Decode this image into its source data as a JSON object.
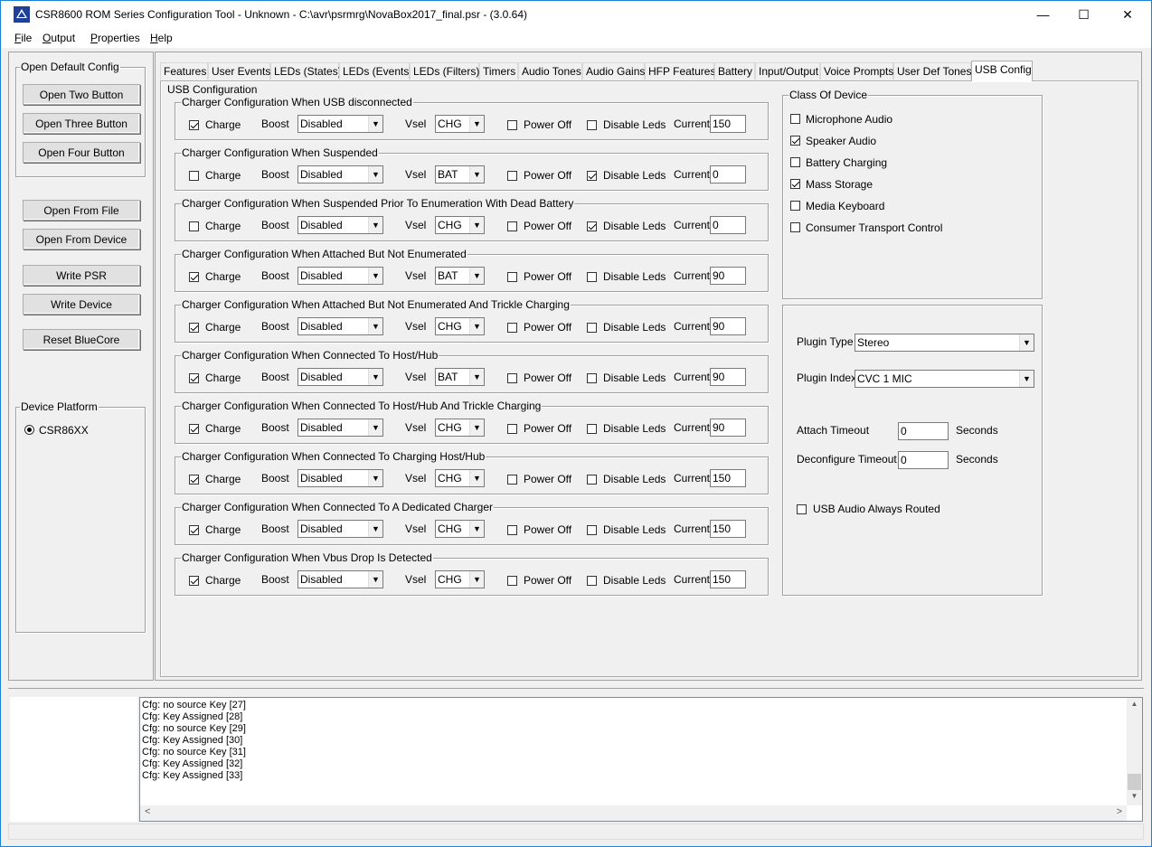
{
  "window": {
    "title": "CSR8600 ROM Series Configuration Tool - Unknown - C:\\avr\\psrmrg\\NovaBox2017_final.psr - (3.0.64)",
    "minimize_label": "—",
    "maximize_label": "☐",
    "close_label": "✕"
  },
  "menubar": {
    "items": [
      {
        "label": "File",
        "underline": "F",
        "rest": "ile"
      },
      {
        "label": "Output",
        "underline": "O",
        "rest": "utput"
      },
      {
        "label": "Properties",
        "underline": "P",
        "rest": "roperties"
      },
      {
        "label": "Help",
        "underline": "H",
        "rest": "elp"
      }
    ]
  },
  "sidebar": {
    "open_default_title": "Open Default Config",
    "open_two": "Open Two Button",
    "open_three": "Open Three Button",
    "open_four": "Open Four Button",
    "open_file": "Open From File",
    "open_device": "Open From Device",
    "write_psr": "Write PSR",
    "write_device": "Write Device",
    "reset": "Reset BlueCore",
    "platform_title": "Device Platform",
    "platform_option": "CSR86XX"
  },
  "tabs": [
    "Features",
    "User Events",
    "LEDs (States)",
    "LEDs (Events)",
    "LEDs (Filters)",
    "Timers",
    "Audio Tones",
    "Audio Gains",
    "HFP Features",
    "Battery",
    "Input/Output",
    "Voice Prompts",
    "User Def Tones",
    "USB Config"
  ],
  "active_tab": "USB Config",
  "usb": {
    "group_title": "USB Configuration",
    "labels": {
      "charge": "Charge",
      "boost": "Boost",
      "vsel": "Vsel",
      "power_off": "Power Off",
      "disable_leds": "Disable Leds",
      "current": "Current"
    },
    "chargers": [
      {
        "title": "Charger Configuration When USB disconnected",
        "charge": true,
        "boost": "Disabled",
        "vsel": "CHG",
        "power_off": false,
        "disable_leds": false,
        "current": "150"
      },
      {
        "title": "Charger Configuration When Suspended",
        "charge": false,
        "boost": "Disabled",
        "vsel": "BAT",
        "power_off": false,
        "disable_leds": true,
        "current": "0"
      },
      {
        "title": "Charger Configuration When Suspended Prior To Enumeration With Dead Battery",
        "charge": false,
        "boost": "Disabled",
        "vsel": "CHG",
        "power_off": false,
        "disable_leds": true,
        "current": "0"
      },
      {
        "title": "Charger Configuration When Attached But Not Enumerated",
        "charge": true,
        "boost": "Disabled",
        "vsel": "BAT",
        "power_off": false,
        "disable_leds": false,
        "current": "90"
      },
      {
        "title": "Charger Configuration When Attached But Not Enumerated And Trickle Charging",
        "charge": true,
        "boost": "Disabled",
        "vsel": "CHG",
        "power_off": false,
        "disable_leds": false,
        "current": "90"
      },
      {
        "title": "Charger Configuration When Connected To Host/Hub",
        "charge": true,
        "boost": "Disabled",
        "vsel": "BAT",
        "power_off": false,
        "disable_leds": false,
        "current": "90"
      },
      {
        "title": "Charger Configuration When Connected To Host/Hub And Trickle Charging",
        "charge": true,
        "boost": "Disabled",
        "vsel": "CHG",
        "power_off": false,
        "disable_leds": false,
        "current": "90"
      },
      {
        "title": "Charger Configuration When Connected To Charging Host/Hub",
        "charge": true,
        "boost": "Disabled",
        "vsel": "CHG",
        "power_off": false,
        "disable_leds": false,
        "current": "150"
      },
      {
        "title": "Charger Configuration When Connected To A Dedicated Charger",
        "charge": true,
        "boost": "Disabled",
        "vsel": "CHG",
        "power_off": false,
        "disable_leds": false,
        "current": "150"
      },
      {
        "title": "Charger Configuration When Vbus Drop Is Detected",
        "charge": true,
        "boost": "Disabled",
        "vsel": "CHG",
        "power_off": false,
        "disable_leds": false,
        "current": "150"
      }
    ]
  },
  "class_of_device": {
    "title": "Class Of Device",
    "items": [
      {
        "label": "Microphone Audio",
        "checked": false
      },
      {
        "label": "Speaker Audio",
        "checked": true
      },
      {
        "label": "Battery Charging",
        "checked": false
      },
      {
        "label": "Mass Storage",
        "checked": true
      },
      {
        "label": "Media Keyboard",
        "checked": false
      },
      {
        "label": "Consumer Transport Control",
        "checked": false
      }
    ]
  },
  "plugin": {
    "type_label": "Plugin Type",
    "type_value": "Stereo",
    "index_label": "Plugin Index",
    "index_value": "CVC 1 MIC",
    "attach_label": "Attach Timeout",
    "attach_value": "0",
    "attach_unit": "Seconds",
    "deconf_label": "Deconfigure Timeout",
    "deconf_value": "0",
    "deconf_unit": "Seconds",
    "always_routed_label": "USB Audio Always Routed",
    "always_routed": false
  },
  "log": {
    "lines": [
      "Cfg: no source Key [27]",
      "Cfg: Key Assigned [28]",
      "Cfg: no source Key [29]",
      "Cfg: Key Assigned [30]",
      "Cfg: no source Key [31]",
      "Cfg: Key Assigned [32]",
      "Cfg: Key Assigned [33]"
    ],
    "scroll_up": "▲",
    "scroll_down": "▼",
    "scroll_left": "<",
    "scroll_right": ">"
  }
}
